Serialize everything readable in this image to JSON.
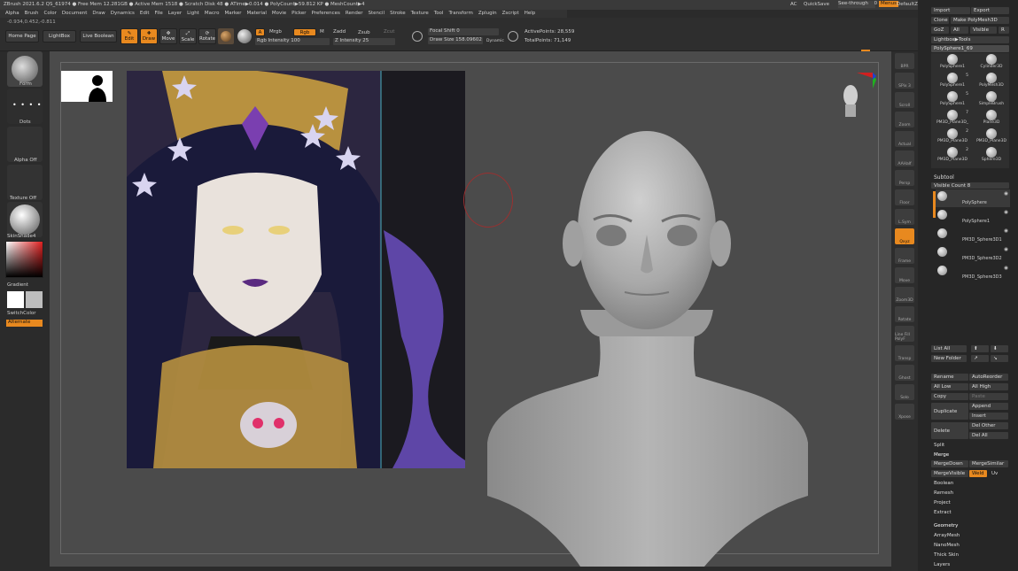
{
  "menu": [
    "Alpha",
    "Brush",
    "Color",
    "Document",
    "Draw",
    "Dynamics",
    "Edit",
    "File",
    "Layer",
    "Light",
    "Macro",
    "Marker",
    "Material",
    "Movie",
    "Picker",
    "Preferences",
    "Render",
    "Stencil",
    "Stroke",
    "Texture",
    "Tool",
    "Transform",
    "Zplugin",
    "Zscript",
    "Help"
  ],
  "title_status": "ZBrush 2021.6.2   QS_61974   ● Free Mem 12.281GB ● Active Mem 1518 ● Scratch Disk 48 ● ATime▶0.014 ● PolyCount▶59.812 KP ● MeshCount▶4",
  "top_right": {
    "ac": "AC",
    "quicksave": "QuickSave",
    "seethrough_label": "See-through",
    "seethrough_value": "0",
    "menus": "Menus",
    "script": "DefaultZScript"
  },
  "coords": "-0.934,0.452,-0.811",
  "toolbar": {
    "home_page": "Home Page",
    "lightbox": "LightBox",
    "live_boolean": "Live Boolean",
    "edit": "Edit",
    "draw": "Draw",
    "move": "Move",
    "scale": "Scale",
    "rotate": "Rotate",
    "a": "A",
    "mrgb": "Mrgb",
    "rgb": "Rgb",
    "m": "M",
    "zadd": "Zadd",
    "zsub": "Zsub",
    "zcut": "Zcut",
    "rgb_intensity_label": "Rgb Intensity",
    "rgb_intensity_value": "100",
    "z_intensity_label": "Z Intensity",
    "z_intensity_value": "25",
    "focal_shift_label": "Focal Shift",
    "focal_shift_value": "0",
    "draw_size_label": "Draw Size",
    "draw_size_value": "158.09602",
    "dynamic": "Dynamic",
    "active_points": "ActivePoints: 28,559",
    "total_points": "TotalPoints: 71,149"
  },
  "left": {
    "brush": "Form",
    "stroke": "Dots",
    "alpha": "Alpha Off",
    "texture": "Texture Off",
    "material": "SkinShade4",
    "gradient": "Gradient",
    "switch_color": "SwitchColor",
    "alternate": "Alternate"
  },
  "shelf": [
    "BPR",
    "SPix 3",
    "Scroll",
    "Zoom",
    "Actual",
    "AAHalf",
    "Persp",
    "Floor",
    "L.Sym",
    "Qxyz",
    "Frame",
    "Move",
    "Zoom3D",
    "Rotate",
    "Line Fill PolyF",
    "Transp",
    "Ghost",
    "Solo",
    "Xpose"
  ],
  "shelf_orange": "Qxyz",
  "tray": {
    "import": "Import",
    "export": "Export",
    "clone": "Clone",
    "make_polymesh": "Make PolyMesh3D",
    "goz": "GoZ",
    "all": "All",
    "visible": "Visible",
    "r": "R",
    "lightbox_tools": "Lightbox▶Tools",
    "current_tool": "PolySphere1_69",
    "tools": [
      {
        "name": "PolySphere1",
        "count": ""
      },
      {
        "name": "Cylinder3D",
        "count": ""
      },
      {
        "name": "PolySphere1",
        "count": "5"
      },
      {
        "name": "PolyMesh3D",
        "count": ""
      },
      {
        "name": "PolySphere1",
        "count": "5"
      },
      {
        "name": "SimpleBrush",
        "count": ""
      },
      {
        "name": "PM3D_Plane3D_",
        "count": "7"
      },
      {
        "name": "Plane3D",
        "count": ""
      },
      {
        "name": "PM3D_Plane3D",
        "count": "2"
      },
      {
        "name": "PM3D_Plane3D",
        "count": ""
      },
      {
        "name": "PM3D_Plane3D",
        "count": "2"
      },
      {
        "name": "Sphere3D",
        "count": ""
      }
    ],
    "subtool": "Subtool",
    "visible_count": "Visible Count 8",
    "subtools": [
      "PolySphere",
      "PolySphere1",
      "PM3D_Sphere3D1",
      "PM3D_Sphere3D2",
      "PM3D_Sphere3D3"
    ],
    "list_all": "List All",
    "new_folder": "New Folder",
    "rename": "Rename",
    "auto_reorder": "AutoReorder",
    "all_low": "All Low",
    "all_high": "All High",
    "copy": "Copy",
    "paste": "Paste",
    "duplicate": "Duplicate",
    "append": "Append",
    "insert": "Insert",
    "delete": "Delete",
    "del_other": "Del Other",
    "del_all": "Del All",
    "split": "Split",
    "merge": "Merge",
    "merge_down": "MergeDown",
    "merge_similar": "MergeSimilar",
    "merge_visible": "MergeVisible",
    "weld": "Weld",
    "uv": "Uv",
    "boolean": "Boolean",
    "remesh": "Remesh",
    "project": "Project",
    "extract": "Extract",
    "geometry": "Geometry",
    "arraymesh": "ArrayMesh",
    "nanomesh": "NanoMesh",
    "thick_skin": "Thick Skin",
    "layers": "Layers"
  },
  "colors": {
    "accent": "#e8891f",
    "bg": "#2b2b2b",
    "viewport": "#4b4b4b"
  }
}
